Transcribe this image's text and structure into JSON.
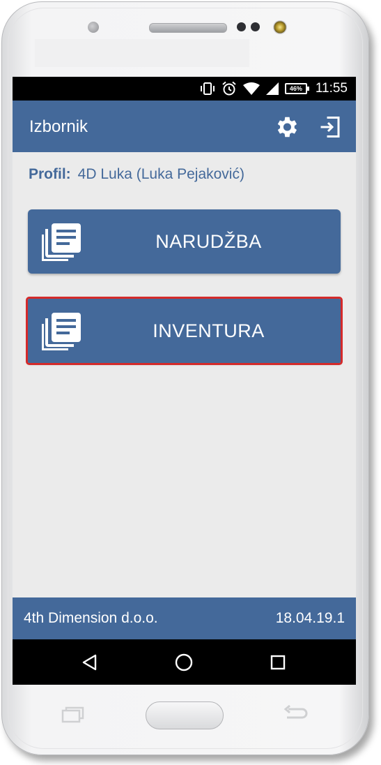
{
  "status_bar": {
    "battery": "46%",
    "time": "11:55",
    "icons": [
      "vibrate-icon",
      "alarm-icon",
      "wifi-icon",
      "signal-icon",
      "battery-icon"
    ]
  },
  "app_bar": {
    "title": "Izbornik",
    "icons": [
      "settings-gear-icon",
      "logout-icon"
    ]
  },
  "profile": {
    "label": "Profil:",
    "value": "4D Luka (Luka Pejaković)"
  },
  "menu": [
    {
      "label": "NARUDŽBA",
      "icon": "documents-icon"
    },
    {
      "label": "INVENTURA",
      "icon": "documents-icon",
      "highlighted": true
    }
  ],
  "footer": {
    "company": "4th Dimension d.o.o.",
    "version": "18.04.19.1"
  },
  "colors": {
    "primary": "#44699a",
    "background": "#ebebeb",
    "highlight": "#d42a2a"
  },
  "nav_bar": [
    "back-icon",
    "home-icon",
    "recent-apps-icon"
  ]
}
